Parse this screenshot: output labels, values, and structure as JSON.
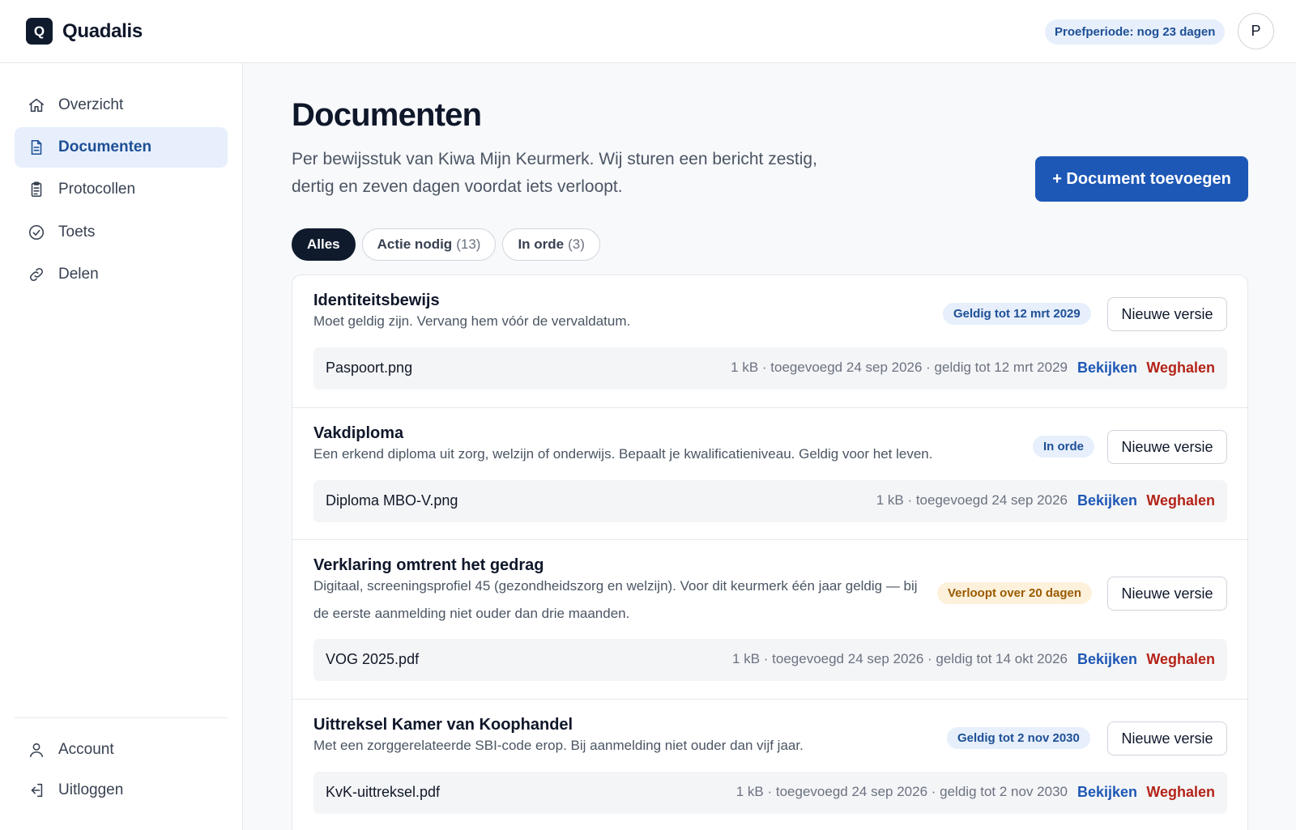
{
  "app": {
    "logo_letter": "Q",
    "name": "Quadalis"
  },
  "header": {
    "trial_label": "Proefperiode: nog 23 dagen",
    "avatar_initial": "P"
  },
  "sidebar": {
    "items": [
      {
        "label": "Overzicht",
        "icon": "home-icon"
      },
      {
        "label": "Documenten",
        "icon": "document-icon",
        "active": true
      },
      {
        "label": "Protocollen",
        "icon": "clipboard-icon"
      },
      {
        "label": "Toets",
        "icon": "check-circle-icon"
      },
      {
        "label": "Delen",
        "icon": "link-icon"
      }
    ],
    "bottom": [
      {
        "label": "Account",
        "icon": "user-icon"
      },
      {
        "label": "Uitloggen",
        "icon": "logout-icon"
      }
    ]
  },
  "main": {
    "title": "Documenten",
    "subtitle": "Per bewijsstuk van Kiwa Mijn Keurmerk. Wij sturen een bericht zestig, dertig en zeven dagen voordat iets verloopt.",
    "add_button": "+ Document toevoegen",
    "filters": [
      {
        "label": "Alles",
        "count": "",
        "active": true
      },
      {
        "label": "Actie nodig",
        "count": "(13)"
      },
      {
        "label": "In orde",
        "count": "(3)"
      }
    ],
    "new_version_label": "Nieuwe versie",
    "view_label": "Bekijken",
    "remove_label": "Weghalen",
    "documents": [
      {
        "title": "Identiteitsbewijs",
        "description": "Moet geldig zijn. Vervang hem vóór de vervaldatum.",
        "badge": "Geldig tot 12 mrt 2029",
        "badge_color": "#1e4f96",
        "file_name": "Paspoort.png",
        "file_meta": "1 kB · toegevoegd 24 sep 2026 · geldig tot 12 mrt 2029"
      },
      {
        "title": "Vakdiploma",
        "description": "Een erkend diploma uit zorg, welzijn of onderwijs. Bepaalt je kwalificatieniveau. Geldig voor het leven.",
        "badge": "In orde",
        "badge_color": "#1e4f96",
        "file_name": "Diploma MBO-V.png",
        "file_meta": "1 kB · toegevoegd 24 sep 2026"
      },
      {
        "title": "Verklaring omtrent het gedrag",
        "description": "Digitaal, screeningsprofiel 45 (gezondheidszorg en welzijn). Voor dit keurmerk één jaar geldig — bij de eerste aanmelding niet ouder dan drie maanden.",
        "badge": "Verloopt over 20 dagen",
        "badge_color": "#9a5b00",
        "file_name": "VOG 2025.pdf",
        "file_meta": "1 kB · toegevoegd 24 sep 2026 · geldig tot 14 okt 2026"
      },
      {
        "title": "Uittreksel Kamer van Koophandel",
        "description": "Met een zorggerelateerde SBI-code erop. Bij aanmelding niet ouder dan vijf jaar.",
        "badge": "Geldig tot 2 nov 2030",
        "badge_color": "#1e4f96",
        "file_name": "KvK-uittreksel.pdf",
        "file_meta": "1 kB · toegevoegd 24 sep 2026 · geldig tot 2 nov 2030"
      }
    ]
  }
}
